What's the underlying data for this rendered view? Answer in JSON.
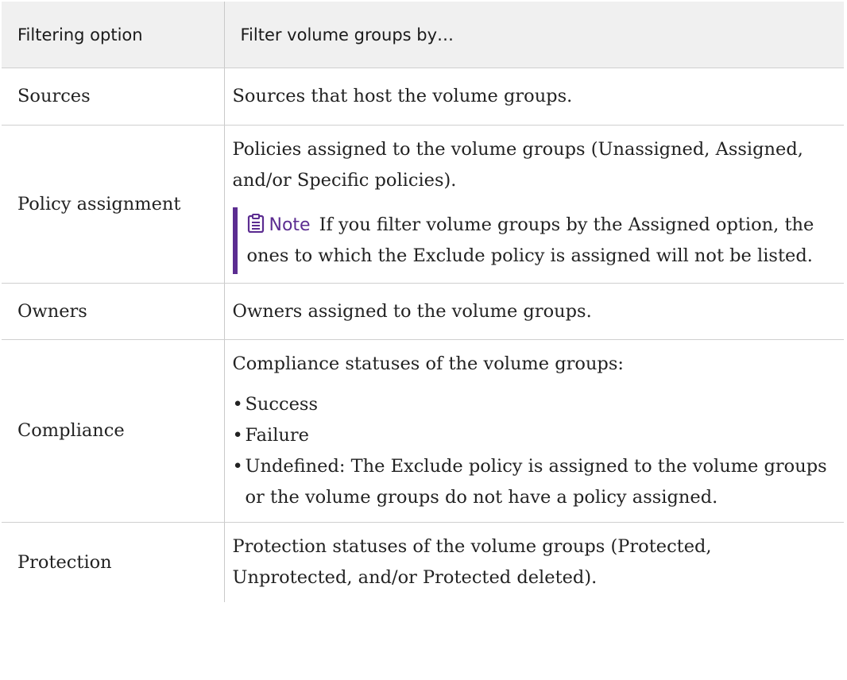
{
  "table": {
    "headers": {
      "option": "Filtering option",
      "filter": "Filter volume groups by…"
    },
    "rows": [
      {
        "option": "Sources",
        "description": "Sources that host the volume groups."
      },
      {
        "option": "Policy assignment",
        "description": "Policies assigned to the volume groups (Unassigned, Assigned, and/or Specific policies).",
        "note": {
          "label": "Note",
          "icon": "clipboard-note-icon",
          "text": "If you filter volume groups by the Assigned option, the ones to which the Exclude policy is assigned will not be listed."
        }
      },
      {
        "option": "Owners",
        "description": "Owners assigned to the volume groups."
      },
      {
        "option": "Compliance",
        "description": "Compliance statuses of the volume groups:",
        "bullets": [
          "Success",
          "Failure",
          "Undefined: The Exclude policy is assigned to the volume groups or the volume groups do not have a policy assigned."
        ]
      },
      {
        "option": "Protection",
        "description": "Protection statuses of the volume groups (Protected, Unprotected, and/or Protected deleted)."
      }
    ]
  },
  "colors": {
    "note_accent": "#5c2d91",
    "header_background": "#f0f0f0"
  }
}
